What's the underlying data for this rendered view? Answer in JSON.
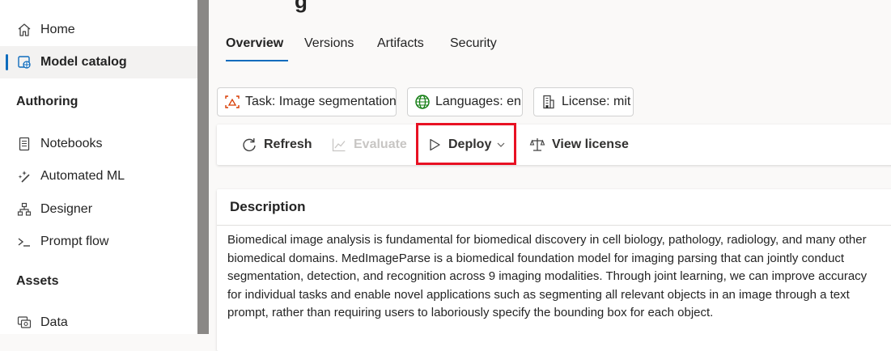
{
  "sidebar": {
    "items": [
      {
        "label": "Home",
        "icon": "home-icon"
      },
      {
        "label": "Model catalog",
        "icon": "model-catalog-icon",
        "selected": true
      }
    ],
    "sections": [
      {
        "heading": "Authoring",
        "items": [
          {
            "label": "Notebooks",
            "icon": "notebook-icon"
          },
          {
            "label": "Automated ML",
            "icon": "automated-ml-icon"
          },
          {
            "label": "Designer",
            "icon": "designer-icon"
          },
          {
            "label": "Prompt flow",
            "icon": "prompt-flow-icon"
          }
        ]
      },
      {
        "heading": "Assets",
        "items": [
          {
            "label": "Data",
            "icon": "data-icon"
          }
        ]
      }
    ]
  },
  "page": {
    "title_fragment": "g"
  },
  "tabs": [
    {
      "label": "Overview",
      "active": true
    },
    {
      "label": "Versions"
    },
    {
      "label": "Artifacts"
    },
    {
      "label": "Security"
    }
  ],
  "chips": {
    "task": "Task: Image segmentation",
    "languages": "Languages: en",
    "license": "License: mit"
  },
  "toolbar": {
    "refresh": "Refresh",
    "evaluate": "Evaluate",
    "deploy": "Deploy",
    "view_license": "View license"
  },
  "description": {
    "heading": "Description",
    "text": "Biomedical image analysis is fundamental for biomedical discovery in cell biology, pathology, radiology, and many other biomedical domains. MedImageParse is a biomedical foundation model for imaging parsing that can jointly conduct segmentation, detection, and recognition across 9 imaging modalities. Through joint learning, we can improve accuracy for individual tasks and enable novel applications such as segmenting all relevant objects in an image through a text prompt, rather than requiring users to laboriously specify the bounding box for each object."
  },
  "colors": {
    "accent": "#0f6cbd",
    "highlight": "#e81123",
    "globe_green": "#107c10",
    "task_orange": "#d83b01"
  }
}
